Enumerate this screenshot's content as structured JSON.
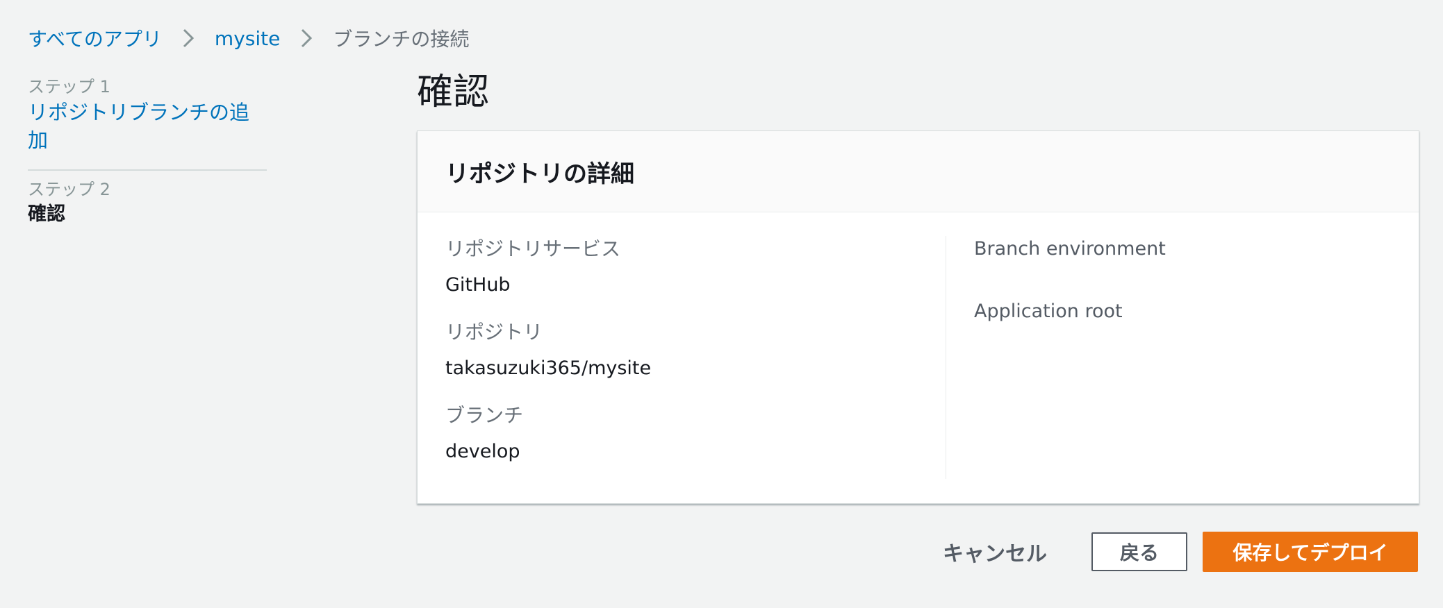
{
  "breadcrumb": {
    "items": [
      "すべてのアプリ",
      "mysite",
      "ブランチの接続"
    ]
  },
  "sidebar": {
    "steps": [
      {
        "caption": "ステップ 1",
        "label": "リポジトリブランチの追加"
      },
      {
        "caption": "ステップ 2",
        "label": "確認"
      }
    ]
  },
  "page": {
    "title": "確認"
  },
  "panel": {
    "title": "リポジトリの詳細",
    "left": [
      {
        "key": "リポジトリサービス",
        "value": "GitHub"
      },
      {
        "key": "リポジトリ",
        "value": "takasuzuki365/mysite"
      },
      {
        "key": "ブランチ",
        "value": "develop"
      }
    ],
    "right": [
      {
        "key": "Branch environment"
      },
      {
        "key": "Application root"
      }
    ]
  },
  "actions": {
    "cancel": "キャンセル",
    "back": "戻る",
    "save_deploy": "保存してデプロイ"
  },
  "colors": {
    "link": "#0073bb",
    "primary": "#ec7211",
    "background": "#f2f3f3"
  },
  "icons": {
    "breadcrumb_separator": "chevron-right-icon"
  }
}
